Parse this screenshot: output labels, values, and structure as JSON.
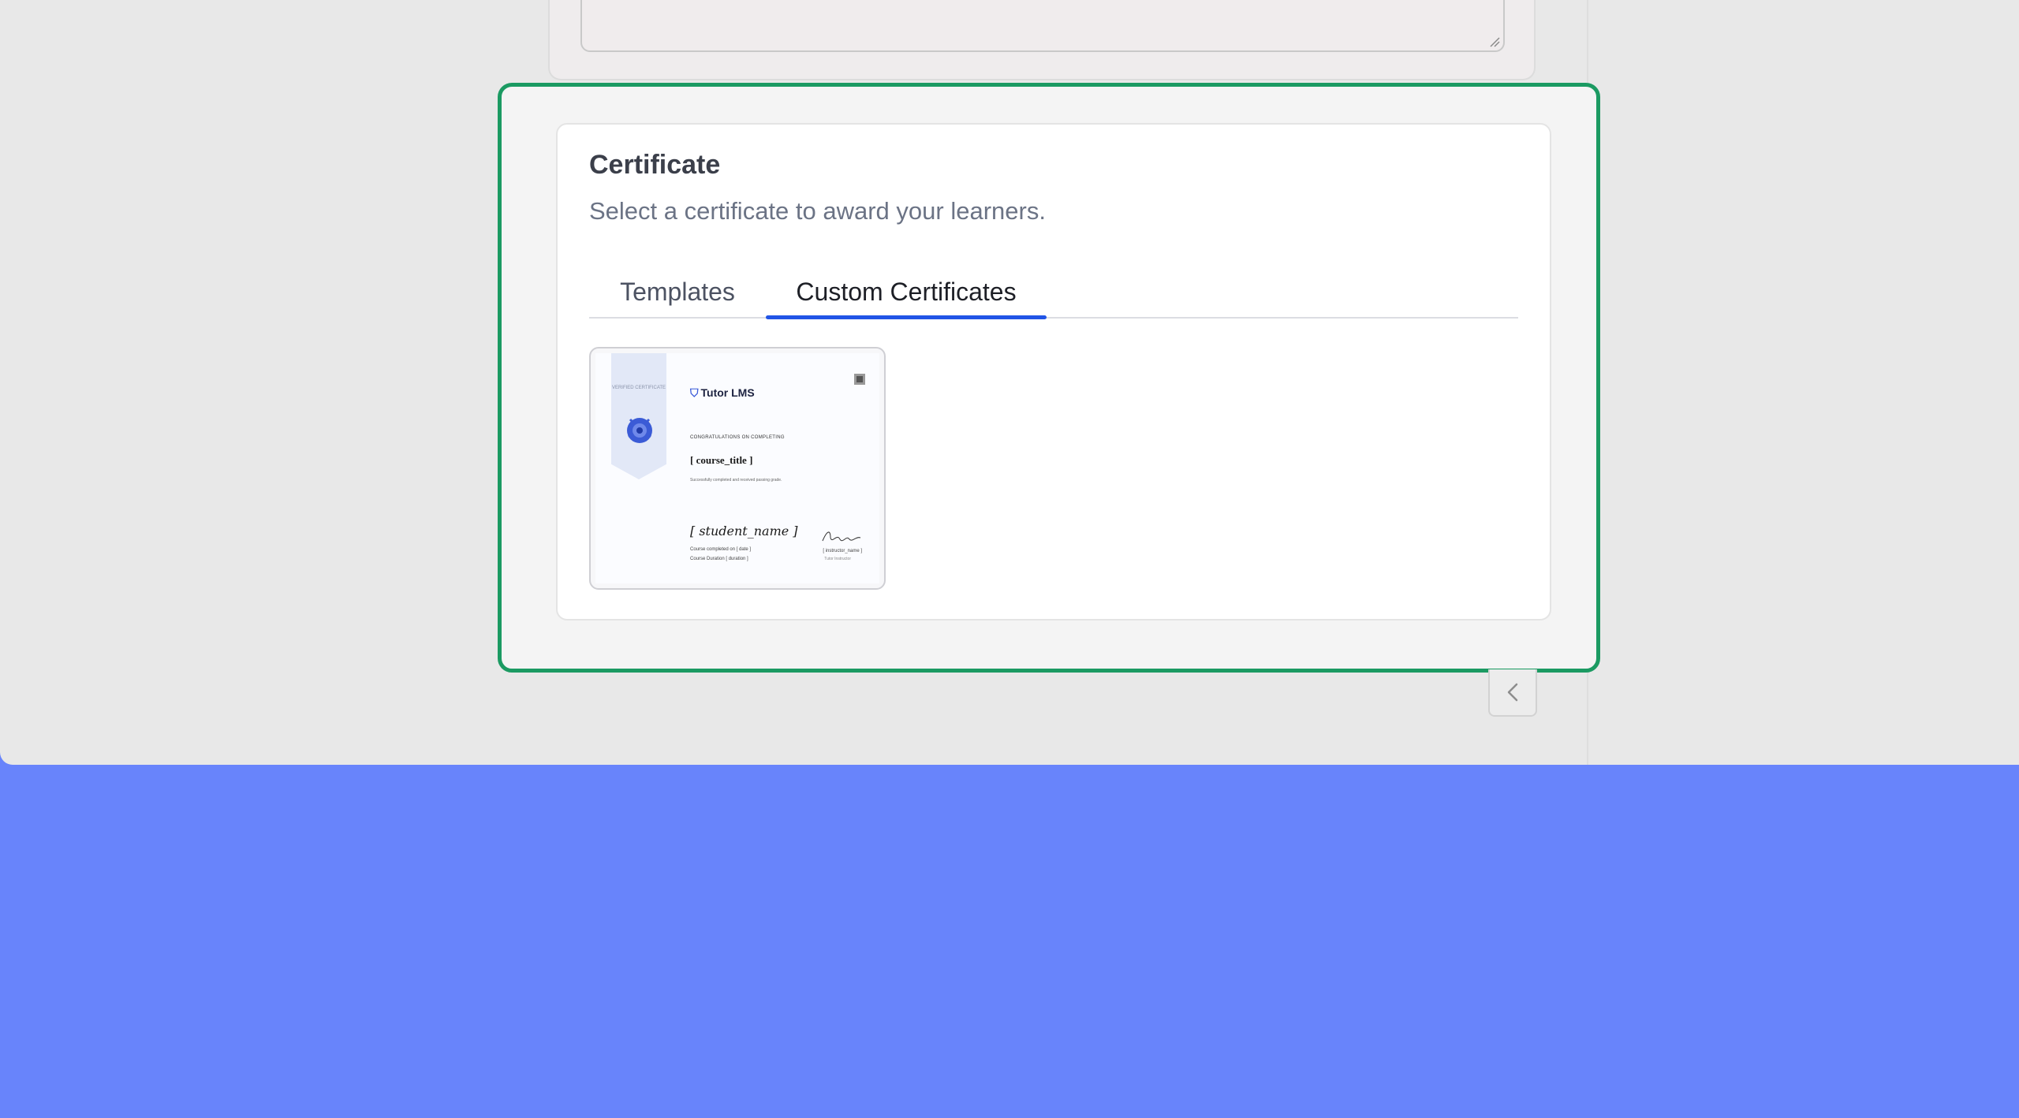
{
  "certificate": {
    "title": "Certificate",
    "subtitle": "Select a certificate to award your learners.",
    "tabs": [
      {
        "label": "Templates",
        "active": false
      },
      {
        "label": "Custom Certificates",
        "active": true
      }
    ],
    "selected_template": {
      "ribbon_text": "VERIFIED CERTIFICATE",
      "brand": "Tutor LMS",
      "congrats": "CONGRATULATIONS ON COMPLETING",
      "course_title": "[ course_title ]",
      "grade_line": "Successfully completed and received passing grade.",
      "student_name": "[ student_name ]",
      "completed_on": "Course completed on [ date ]",
      "course_duration": "Course Duration [ duration ]",
      "instructor": "[ instructor_name ]",
      "instructor_title": "Tutor Instructor"
    }
  },
  "colors": {
    "accent_tab": "#2154e6",
    "highlight_frame": "#1b9a62",
    "page_background": "#6884fb"
  },
  "icons": {
    "collapse": "chevron-left-icon",
    "resize": "resize-grip-icon"
  }
}
